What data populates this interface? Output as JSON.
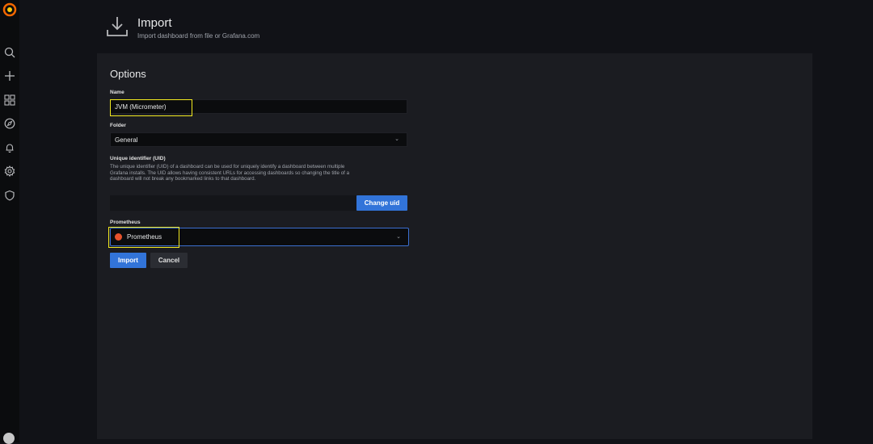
{
  "header": {
    "title": "Import",
    "subtitle": "Import dashboard from file or Grafana.com"
  },
  "sidebar": {
    "items": [
      {
        "name": "search",
        "icon": "search-icon"
      },
      {
        "name": "create",
        "icon": "plus-icon"
      },
      {
        "name": "dashboards",
        "icon": "dashboards-grid-icon"
      },
      {
        "name": "explore",
        "icon": "compass-icon"
      },
      {
        "name": "alerting",
        "icon": "bell-icon"
      },
      {
        "name": "configuration",
        "icon": "gear-icon"
      },
      {
        "name": "server-admin",
        "icon": "shield-icon"
      }
    ]
  },
  "options": {
    "title": "Options",
    "name_label": "Name",
    "name_value": "JVM (Micrometer)",
    "folder_label": "Folder",
    "folder_value": "General",
    "uid_label": "Unique identifier (UID)",
    "uid_description": "The unique identifier (UID) of a dashboard can be used for uniquely identify a dashboard between multiple Grafana installs. The UID allows having consistent URLs for accessing dashboards so changing the title of a dashboard will not break any bookmarked links to that dashboard.",
    "uid_value": "",
    "change_uid_label": "Change uid",
    "prometheus_label": "Prometheus",
    "prometheus_value": "Prometheus",
    "import_label": "Import",
    "cancel_label": "Cancel"
  },
  "colors": {
    "accent_blue": "#3274d9",
    "highlight_yellow": "#f2e91f",
    "grafana_orange": "#f46800",
    "prometheus_orange": "#e6522c"
  }
}
